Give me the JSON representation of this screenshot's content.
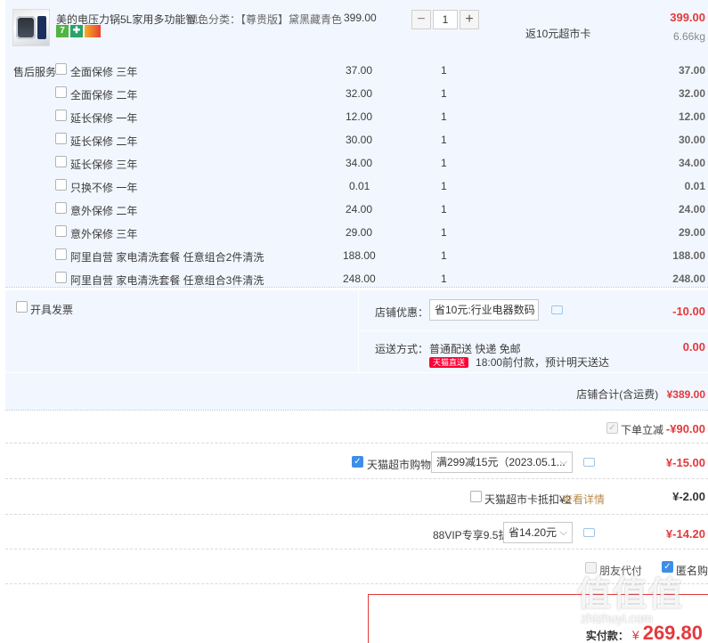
{
  "product": {
    "title": "美的电压力锅5L家用多功能智...",
    "sku_label": "颜色分类：【尊贵版】黛黑藏青色",
    "unit_price": "399.00",
    "quantity": "1",
    "rebate": "返10元超市卡",
    "subtotal": "399.00",
    "weight": "6.66kg",
    "tag_seven": "7"
  },
  "services": {
    "label": "售后服务",
    "items": [
      {
        "name": "全面保修 三年",
        "price": "37.00",
        "qty": "1",
        "total": "37.00"
      },
      {
        "name": "全面保修 二年",
        "price": "32.00",
        "qty": "1",
        "total": "32.00"
      },
      {
        "name": "延长保修 一年",
        "price": "12.00",
        "qty": "1",
        "total": "12.00"
      },
      {
        "name": "延长保修 二年",
        "price": "30.00",
        "qty": "1",
        "total": "30.00"
      },
      {
        "name": "延长保修 三年",
        "price": "34.00",
        "qty": "1",
        "total": "34.00"
      },
      {
        "name": "只换不修 一年",
        "price": "0.01",
        "qty": "1",
        "total": "0.01"
      },
      {
        "name": "意外保修 二年",
        "price": "24.00",
        "qty": "1",
        "total": "24.00"
      },
      {
        "name": "意外保修 三年",
        "price": "29.00",
        "qty": "1",
        "total": "29.00"
      },
      {
        "name": "阿里自营 家电清洗套餐 任意组合2件清洗",
        "price": "188.00",
        "qty": "1",
        "total": "188.00"
      },
      {
        "name": "阿里自营 家电清洗套餐 任意组合3件清洗",
        "price": "248.00",
        "qty": "1",
        "total": "248.00"
      }
    ]
  },
  "invoice": {
    "label": "开具发票"
  },
  "store_discount": {
    "label": "店铺优惠：",
    "selected": "省10元:行业电器数码",
    "amount": "-10.00"
  },
  "shipping": {
    "label": "运送方式：",
    "method": "普通配送 快递 免邮",
    "badge": "天猫直送",
    "note": "18:00前付款，预计明天送达",
    "amount": "0.00"
  },
  "store_total": {
    "label": "店铺合计(含运费)",
    "amount": "¥389.00"
  },
  "order_discount": {
    "label": "下单立减",
    "amount": "-¥90.00"
  },
  "coupon": {
    "label": "天猫超市购物券",
    "selected": "满299减15元（2023.05.1...",
    "amount": "¥-15.00"
  },
  "card_deduct": {
    "label": "天猫超市卡抵扣¥2",
    "link": "查看详情",
    "amount": "¥-2.00"
  },
  "vip": {
    "label": "88VIP专享9.5折",
    "selected": "省14.20元",
    "amount": "¥-14.20"
  },
  "options": {
    "friend_pay": "朋友代付",
    "anonymous": "匿名购买"
  },
  "final": {
    "label": "实付款：",
    "currency": "¥",
    "amount": "269.80"
  },
  "watermark": {
    "text": "值值值",
    "sub": "zhizhuyi.com"
  },
  "colors": {
    "accent_red": "#e4393c",
    "bg_blue": "#f2f7ff",
    "checkbox_blue": "#3e8ee8"
  }
}
